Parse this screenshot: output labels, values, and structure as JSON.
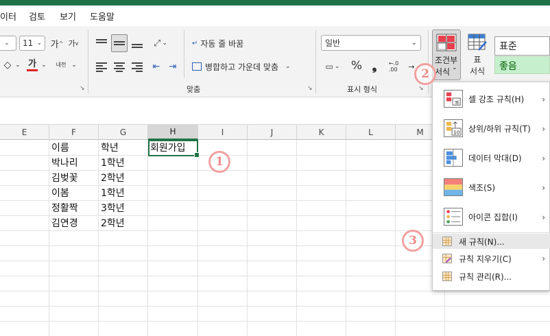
{
  "menu": [
    "이터",
    "검토",
    "보기",
    "도움말"
  ],
  "ribbon": {
    "font_size": "11",
    "font_grow": "가",
    "font_shrink": "가",
    "font_color_glyph": "가",
    "phonetic_glyph": "내천",
    "wrap_text": "자동 줄 바꿈",
    "merge_center": "병합하고 가운데 맞춤",
    "number_format": "일반",
    "percent": "%",
    "comma": "❟",
    "decimal_inc": "←.0\n.00",
    "alignment_group": "맞춤",
    "number_group": "표시 형식",
    "cf_label_1": "조건부",
    "cf_label_2": "서식",
    "table_label_1": "표",
    "table_label_2": "서식",
    "style_normal": "표준",
    "style_good": "좋음",
    "cf_color": "#e8404f",
    "accent_green": "#217346"
  },
  "columns": [
    "E",
    "F",
    "G",
    "H",
    "I",
    "J",
    "K",
    "L",
    "M"
  ],
  "selected_column": "H",
  "cells": {
    "header_name": "이름",
    "header_grade": "학년",
    "header_join": "회원가입",
    "rows": [
      {
        "name": "박나리",
        "grade": "1학년"
      },
      {
        "name": "김벚꽃",
        "grade": "2학년"
      },
      {
        "name": "이봄",
        "grade": "1학년"
      },
      {
        "name": "정활짝",
        "grade": "3학년"
      },
      {
        "name": "김연경",
        "grade": "2학년"
      }
    ]
  },
  "dropdown": {
    "items": [
      {
        "label": "셀 강조 규칙(H)",
        "icon": "highlight-rules-icon",
        "submenu": true
      },
      {
        "label": "상위/하위 규칙(T)",
        "icon": "top-bottom-rules-icon",
        "submenu": true
      },
      {
        "label": "데이터 막대(D)",
        "icon": "data-bars-icon",
        "submenu": true
      },
      {
        "label": "색조(S)",
        "icon": "color-scales-icon",
        "submenu": true
      },
      {
        "label": "아이콘 집합(I)",
        "icon": "icon-sets-icon",
        "submenu": true
      }
    ],
    "new_rule": "새 규칙(N)...",
    "clear_rules": "규칙 지우기(C)",
    "manage_rules": "규칙 관리(R)...",
    "icon_10": "10",
    "icon_lte": "≤"
  },
  "badges": [
    "1",
    "2",
    "3"
  ]
}
